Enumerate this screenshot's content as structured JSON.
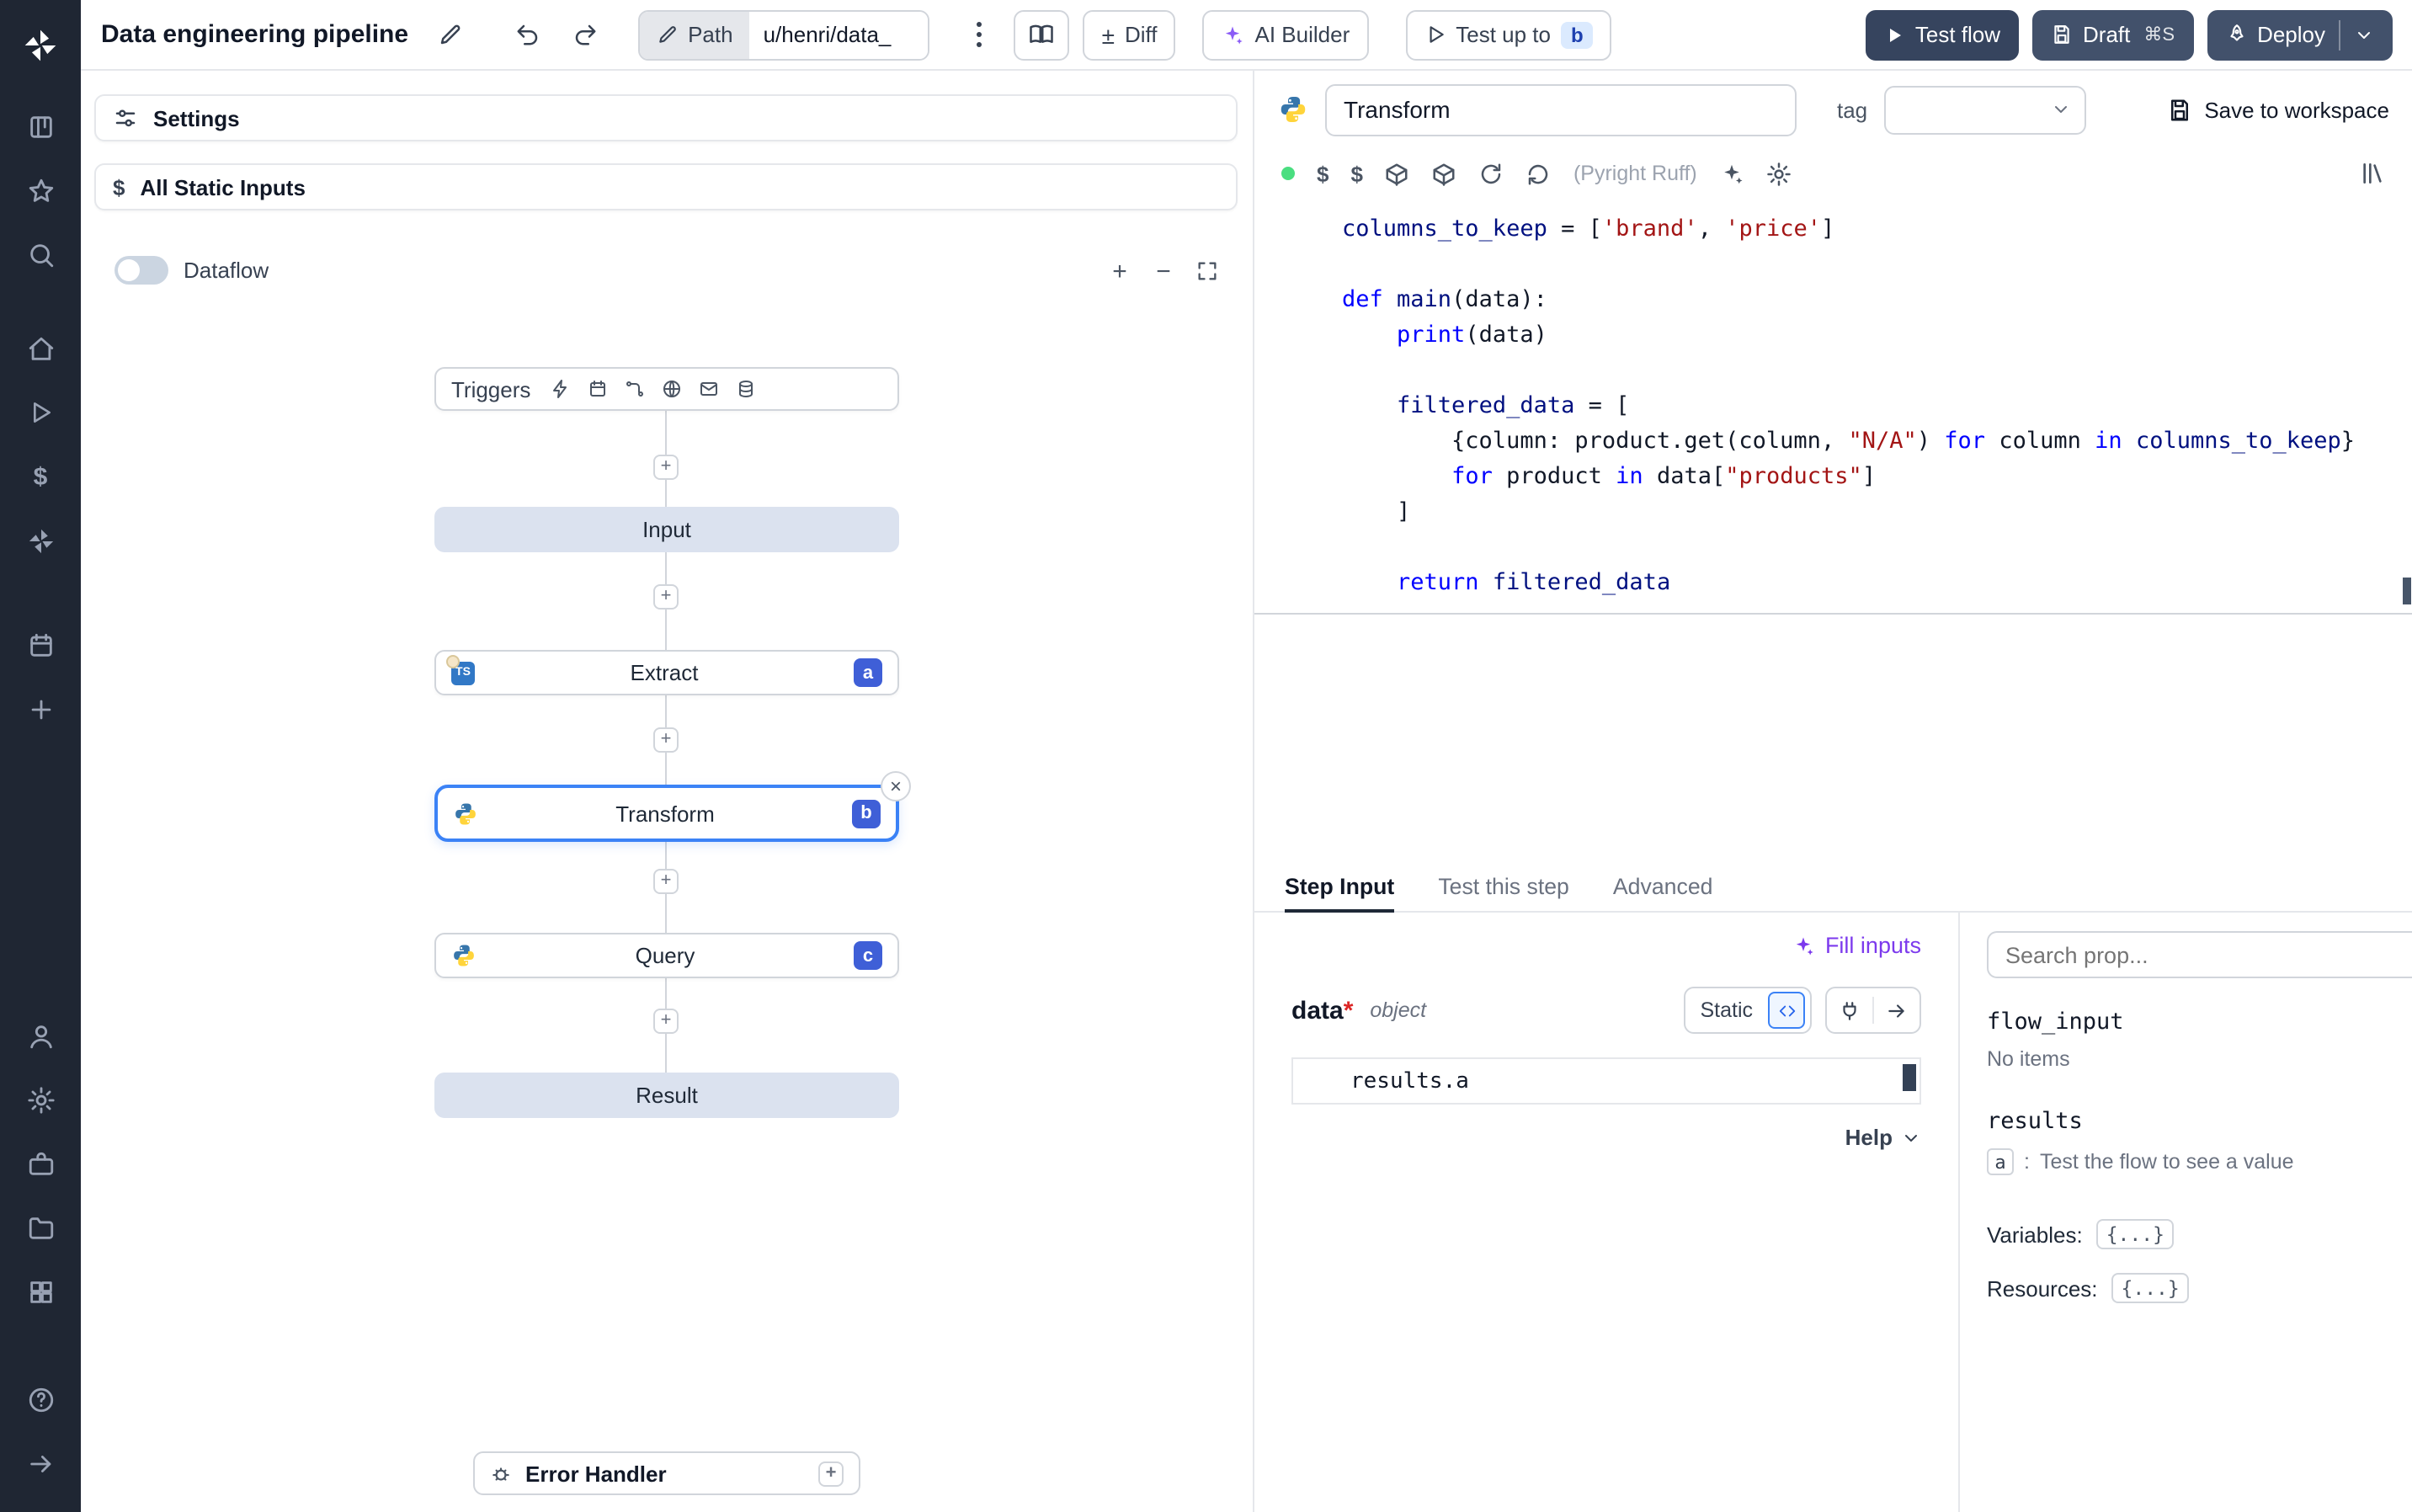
{
  "colors": {
    "sidebar_bg": "#1f2633",
    "primary_dark_button": "#36445e",
    "secondary_dark_button": "#42516b",
    "accent_blue": "#3b82f6",
    "node_badge_bg": "#3f5fd7",
    "virtual_node_bg": "#dbe2ef",
    "violet_accent": "#7c3aed",
    "green_status_dot": "#4ade80",
    "code_keyword": "#0000ff",
    "code_string": "#a31515",
    "code_variable": "#001080",
    "test_up_to_badge_bg": "#dbeafe"
  },
  "sidebar": {
    "icons": [
      "windmill-logo",
      "kanban",
      "star",
      "search",
      "home",
      "play",
      "dollar",
      "hub-pinwheel",
      "calendar",
      "plus",
      "user",
      "settings-gear",
      "workers-briefcase",
      "folders",
      "apps-grid",
      "help",
      "collapse-arrow"
    ]
  },
  "topbar": {
    "title": "Data engineering pipeline",
    "path_label": "Path",
    "path_value": "u/henri/data_",
    "diff_label": "Diff",
    "ai_builder_label": "AI Builder",
    "test_up_to_label": "Test up to",
    "test_up_to_badge": "b",
    "test_flow_label": "Test flow",
    "draft_label": "Draft",
    "draft_shortcut": "⌘S",
    "deploy_label": "Deploy"
  },
  "left_panel": {
    "settings_label": "Settings",
    "all_static_inputs_label": "All Static Inputs",
    "dataflow_label": "Dataflow"
  },
  "flow": {
    "triggers_label": "Triggers",
    "trigger_icons": [
      "webhook",
      "schedule",
      "http-route",
      "websocket",
      "email",
      "database"
    ],
    "nodes": [
      {
        "label": "Input",
        "kind": "virtual"
      },
      {
        "label": "Extract",
        "badge": "a",
        "lang": "typescript"
      },
      {
        "label": "Transform",
        "badge": "b",
        "lang": "python",
        "selected": true
      },
      {
        "label": "Query",
        "badge": "c",
        "lang": "python"
      },
      {
        "label": "Result",
        "kind": "virtual"
      }
    ],
    "error_handler_label": "Error Handler"
  },
  "editor": {
    "step_name": "Transform",
    "tag_label": "tag",
    "save_label": "Save to workspace",
    "lint_label": "(Pyright Ruff)",
    "language": "python",
    "code_lines": [
      [
        {
          "c": "v",
          "t": "columns_to_keep"
        },
        {
          "c": "p",
          "t": " = ["
        },
        {
          "c": "s",
          "t": "'brand'"
        },
        {
          "c": "p",
          "t": ", "
        },
        {
          "c": "s",
          "t": "'price'"
        },
        {
          "c": "p",
          "t": "]"
        }
      ],
      [],
      [
        {
          "c": "k",
          "t": "def "
        },
        {
          "c": "f",
          "t": "main"
        },
        {
          "c": "p",
          "t": "(data):"
        }
      ],
      [
        {
          "c": "p",
          "t": "    "
        },
        {
          "c": "k",
          "t": "print"
        },
        {
          "c": "p",
          "t": "(data)"
        }
      ],
      [],
      [
        {
          "c": "p",
          "t": "    "
        },
        {
          "c": "v",
          "t": "filtered_data"
        },
        {
          "c": "p",
          "t": " = ["
        }
      ],
      [
        {
          "c": "p",
          "t": "        {column: product.get(column, "
        },
        {
          "c": "s",
          "t": "\"N/A\""
        },
        {
          "c": "p",
          "t": ") "
        },
        {
          "c": "k",
          "t": "for"
        },
        {
          "c": "p",
          "t": " column "
        },
        {
          "c": "k",
          "t": "in"
        },
        {
          "c": "p",
          "t": " "
        },
        {
          "c": "v",
          "t": "columns_to_keep"
        },
        {
          "c": "p",
          "t": "}"
        }
      ],
      [
        {
          "c": "p",
          "t": "        "
        },
        {
          "c": "k",
          "t": "for"
        },
        {
          "c": "p",
          "t": " product "
        },
        {
          "c": "k",
          "t": "in"
        },
        {
          "c": "p",
          "t": " data["
        },
        {
          "c": "s",
          "t": "\"products\""
        },
        {
          "c": "p",
          "t": "]"
        }
      ],
      [
        {
          "c": "p",
          "t": "    ]"
        }
      ],
      [],
      [
        {
          "c": "p",
          "t": "    "
        },
        {
          "c": "k",
          "t": "return"
        },
        {
          "c": "p",
          "t": " "
        },
        {
          "c": "v",
          "t": "filtered_data"
        }
      ]
    ]
  },
  "step_panel": {
    "tabs": [
      {
        "label": "Step Input"
      },
      {
        "label": "Test this step"
      },
      {
        "label": "Advanced"
      }
    ],
    "active_tab": "Step Input",
    "fill_inputs_label": "Fill inputs",
    "arg_name": "data",
    "arg_required_marker": "*",
    "arg_type": "object",
    "static_label": "Static",
    "input_value": "results.a",
    "help_label": "Help"
  },
  "props_panel": {
    "search_placeholder": "Search prop...",
    "flow_input_label": "flow_input",
    "flow_input_empty": "No items",
    "results_label": "results",
    "result_key": "a",
    "separator": ":",
    "result_hint": "Test the flow to see a value",
    "variables_label": "Variables:",
    "variables_value": "{...}",
    "resources_label": "Resources:",
    "resources_value": "{...}"
  }
}
